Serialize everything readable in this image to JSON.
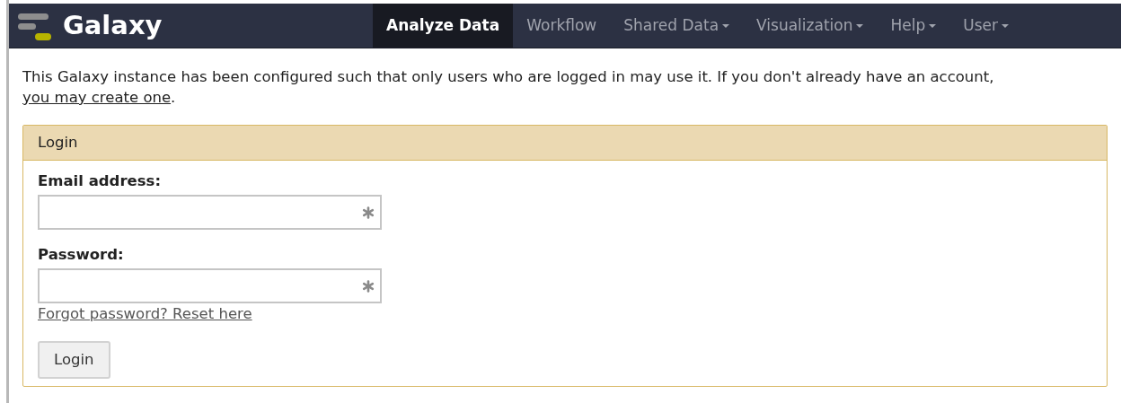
{
  "brand": {
    "name": "Galaxy"
  },
  "nav": [
    {
      "label": "Analyze Data",
      "selected": true,
      "dropdown": false
    },
    {
      "label": "Workflow",
      "selected": false,
      "dropdown": false
    },
    {
      "label": "Shared Data",
      "selected": false,
      "dropdown": true
    },
    {
      "label": "Visualization",
      "selected": false,
      "dropdown": true
    },
    {
      "label": "Help",
      "selected": false,
      "dropdown": true
    },
    {
      "label": "User",
      "selected": false,
      "dropdown": true
    }
  ],
  "intro": {
    "text": "This Galaxy instance has been configured such that only users who are logged in may use it. If you don't already have an account,",
    "link": "you may create one",
    "after": "."
  },
  "login_panel": {
    "title": "Login",
    "fields": [
      {
        "label": "Email address:",
        "required": true
      },
      {
        "label": "Password:",
        "required": true
      }
    ],
    "forgot_link": "Forgot password? Reset here",
    "submit": "Login"
  }
}
